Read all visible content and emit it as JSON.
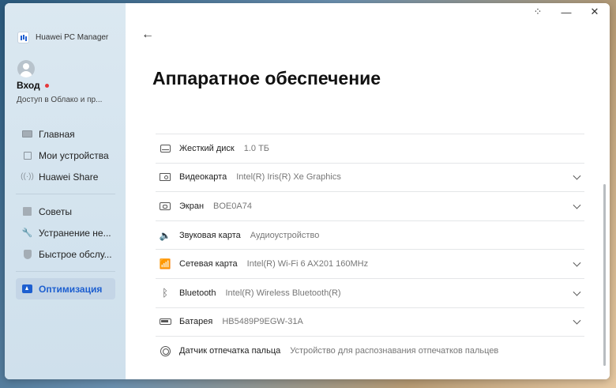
{
  "app": {
    "name": "Huawei PC Manager"
  },
  "window_controls": {
    "snap": "⁘",
    "minimize": "—",
    "close": "✕"
  },
  "user": {
    "login_label": "Вход",
    "subtitle": "Доступ в Облако и пр..."
  },
  "sidebar": {
    "group1": [
      {
        "label": "Главная",
        "icon": "home-icon"
      },
      {
        "label": "Мои устройства",
        "icon": "devices-icon"
      },
      {
        "label": "Huawei Share",
        "icon": "share-icon"
      }
    ],
    "group2": [
      {
        "label": "Советы",
        "icon": "tips-icon"
      },
      {
        "label": "Устранение не...",
        "icon": "wrench-icon"
      },
      {
        "label": "Быстрое обслу...",
        "icon": "shield-icon"
      }
    ],
    "active": {
      "label": "Оптимизация",
      "icon": "optimize-icon"
    }
  },
  "page": {
    "back_icon": "←",
    "title": "Аппаратное обеспечение"
  },
  "hardware": [
    {
      "name": "Жесткий диск",
      "value": "1.0 ТБ",
      "icon": "disk-icon",
      "expandable": false
    },
    {
      "name": "Видеокарта",
      "value": "Intel(R) Iris(R) Xe Graphics",
      "icon": "gpu-icon",
      "expandable": true
    },
    {
      "name": "Экран",
      "value": "BOE0A74",
      "icon": "screen-icon",
      "expandable": true
    },
    {
      "name": "Звуковая карта",
      "value": "Аудиоустройство",
      "icon": "speaker-icon",
      "expandable": false
    },
    {
      "name": "Сетевая карта",
      "value": "Intel(R) Wi-Fi 6 AX201 160MHz",
      "icon": "wifi-icon",
      "expandable": true
    },
    {
      "name": "Bluetooth",
      "value": "Intel(R) Wireless Bluetooth(R)",
      "icon": "bluetooth-icon",
      "expandable": true
    },
    {
      "name": "Батарея",
      "value": "HB5489P9EGW-31A",
      "icon": "battery-icon",
      "expandable": true
    },
    {
      "name": "Датчик отпечатка пальца",
      "value": "Устройство для распознавания отпечатков пальцев",
      "icon": "fingerprint-icon",
      "expandable": false
    }
  ],
  "colors": {
    "accent": "#1d5fd0",
    "sidebar_bg": "#d6e5ef",
    "notify_dot": "#e5383b"
  }
}
